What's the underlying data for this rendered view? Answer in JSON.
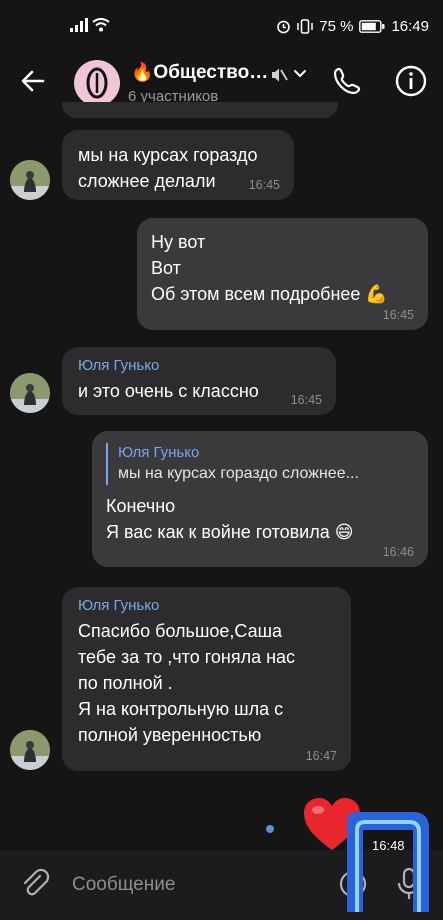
{
  "status": {
    "signal": "signal-icon",
    "wifi": "wifi-icon",
    "alarm": "alarm-icon",
    "vibrate": "vibrate-icon",
    "battery_pct": "75 %",
    "time": "16:49"
  },
  "header": {
    "title": "Общество…",
    "title_emoji": "🔥",
    "subtitle": "6 участников"
  },
  "messages": [
    {
      "text": "мы на курсах гораздо\nсложнее делали",
      "time": "16:45"
    },
    {
      "text": "Ну вот\nВот\nОб этом всем подробнее 💪",
      "time": "16:45"
    },
    {
      "sender": "Юля Гунько",
      "text": "и это очень с классно",
      "time": "16:45"
    },
    {
      "reply_name": "Юля Гунько",
      "reply_text": "мы на курсах гораздо сложнее...",
      "text": "Конечно\nЯ вас как к войне готовила 😄",
      "time": "16:46"
    },
    {
      "sender": "Юля Гунько",
      "text": "Спасибо большое,Саша\nтебе за то ,что гоняла нас\nпо полной .\nЯ на контрольную шла с\nполной уверенностью",
      "time": "16:47"
    }
  ],
  "overlay_time": "16:48",
  "composer": {
    "placeholder": "Сообщение"
  },
  "colors": {
    "background": "#151516",
    "bubble_in": "#2c2c2e",
    "bubble_out": "#3a3a3c",
    "accent": "#76a9ea"
  }
}
